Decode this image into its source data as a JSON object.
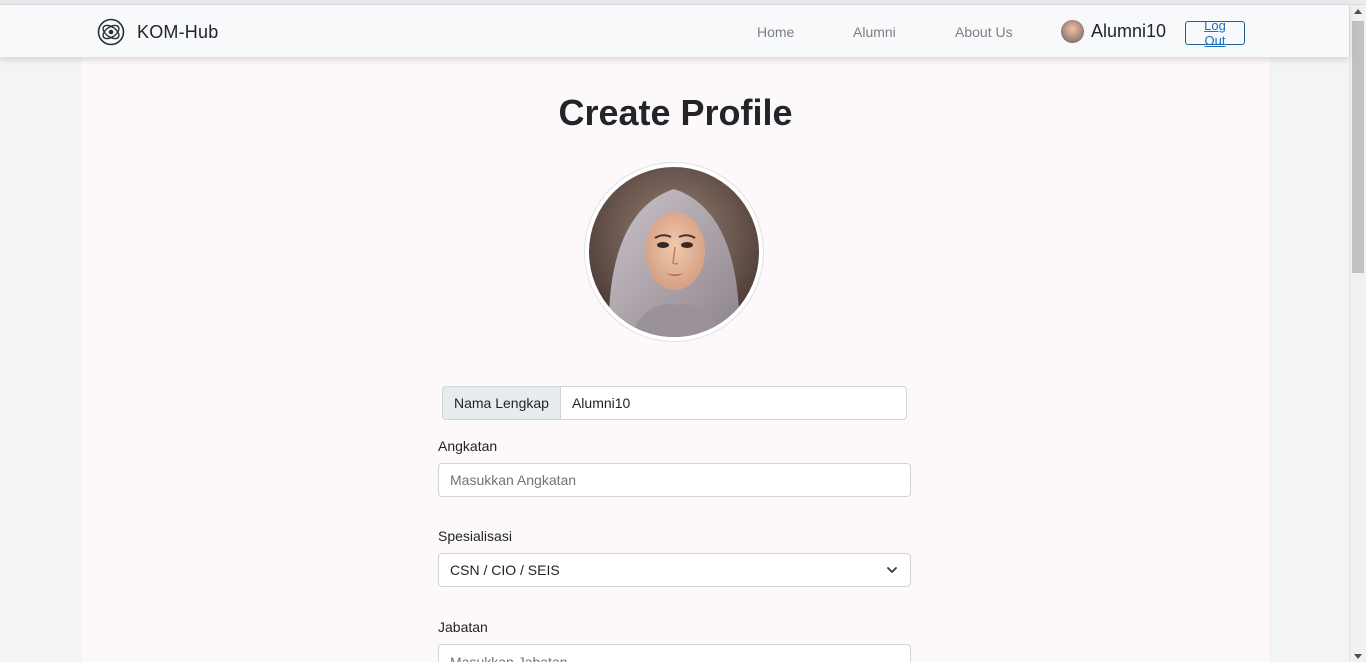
{
  "navbar": {
    "brand": "KOM-Hub",
    "brand_icon": "atom-logo-icon",
    "links": [
      "Home",
      "Alumni",
      "About Us"
    ],
    "user_name": "Alumni10",
    "logout_label": "Log Out"
  },
  "page": {
    "title": "Create Profile"
  },
  "form": {
    "nama_lengkap_label": "Nama Lengkap",
    "nama_lengkap_value": "Alumni10",
    "angkatan_label": "Angkatan",
    "angkatan_placeholder": "Masukkan Angkatan",
    "spesialisasi_label": "Spesialisasi",
    "spesialisasi_value": "CSN / CIO / SEIS",
    "jabatan_label": "Jabatan",
    "jabatan_placeholder": "Masukkan Jabatan"
  },
  "colors": {
    "navbar_bg": "#f8f9fa",
    "page_bg": "#fdf9fa",
    "logout_border": "#1f5f9e",
    "logout_text": "#1f6fc1"
  }
}
